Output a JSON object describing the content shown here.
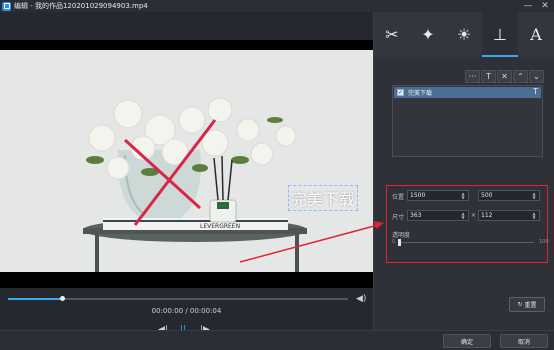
{
  "window": {
    "title": "编辑 - 我的作品120201029094903.mp4",
    "minimize": "—",
    "close": "✕"
  },
  "tabs": [
    {
      "name": "cut",
      "glyph": "✂"
    },
    {
      "name": "magic",
      "glyph": "✦"
    },
    {
      "name": "brightness",
      "glyph": "☀"
    },
    {
      "name": "stamp",
      "glyph": "⊥"
    },
    {
      "name": "text",
      "glyph": "A"
    }
  ],
  "text_tools": {
    "more": "···",
    "add_text": "T",
    "delete": "✕",
    "up": "⌃",
    "down": "⌄"
  },
  "text_list": {
    "items": [
      {
        "label": "完美下载",
        "checked": true,
        "type_glyph": "T"
      }
    ]
  },
  "video": {
    "overlay_text": "完美下载"
  },
  "properties": {
    "position_label": "位置",
    "position_x": "1500",
    "position_y": "500",
    "size_label": "尺寸",
    "size_w": "363",
    "size_h": "112",
    "size_sep": "×",
    "opacity_label": "透明度",
    "opacity_min": "0",
    "opacity_max": "100",
    "opacity_value": 0
  },
  "playback": {
    "time": "00:00:00 / 00:00:04",
    "progress": 0.16,
    "prev": "◀|",
    "play": "||",
    "next": "|▶",
    "volume": "◀)"
  },
  "reset_button": {
    "icon": "↻",
    "label": "重置"
  },
  "footer": {
    "ok": "确定",
    "cancel": "取消"
  },
  "colors": {
    "accent": "#39a8f0",
    "annotation": "#e0252f"
  }
}
